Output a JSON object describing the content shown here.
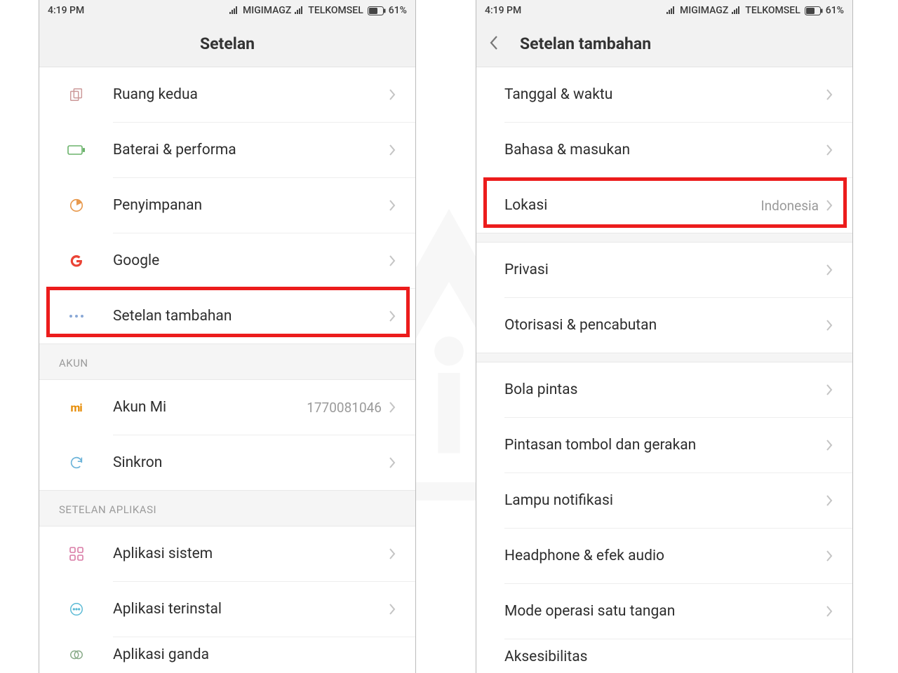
{
  "status": {
    "time": "4:19 PM",
    "carrier1": "MIGIMAGZ",
    "carrier2": "TELKOMSEL",
    "battery": "61%"
  },
  "left": {
    "title": "Setelan",
    "rows": {
      "ruang_kedua": "Ruang kedua",
      "baterai": "Baterai & performa",
      "penyimpanan": "Penyimpanan",
      "google": "Google",
      "setelan_tambahan": "Setelan tambahan",
      "akun_mi": "Akun Mi",
      "akun_mi_val": "1770081046",
      "sinkron": "Sinkron",
      "aplikasi_sistem": "Aplikasi sistem",
      "aplikasi_terinstal": "Aplikasi terinstal",
      "aplikasi_ganda": "Aplikasi ganda"
    },
    "sections": {
      "akun": "AKUN",
      "setelan_aplikasi": "SETELAN APLIKASI"
    }
  },
  "right": {
    "title": "Setelan tambahan",
    "rows": {
      "tanggal": "Tanggal & waktu",
      "bahasa": "Bahasa & masukan",
      "lokasi": "Lokasi",
      "lokasi_val": "Indonesia",
      "privasi": "Privasi",
      "otorisasi": "Otorisasi & pencabutan",
      "bola": "Bola pintas",
      "pintasan": "Pintasan tombol dan gerakan",
      "lampu": "Lampu notifikasi",
      "headphone": "Headphone & efek audio",
      "mode_satu": "Mode operasi satu tangan",
      "aksesibilitas": "Aksesibilitas"
    }
  }
}
